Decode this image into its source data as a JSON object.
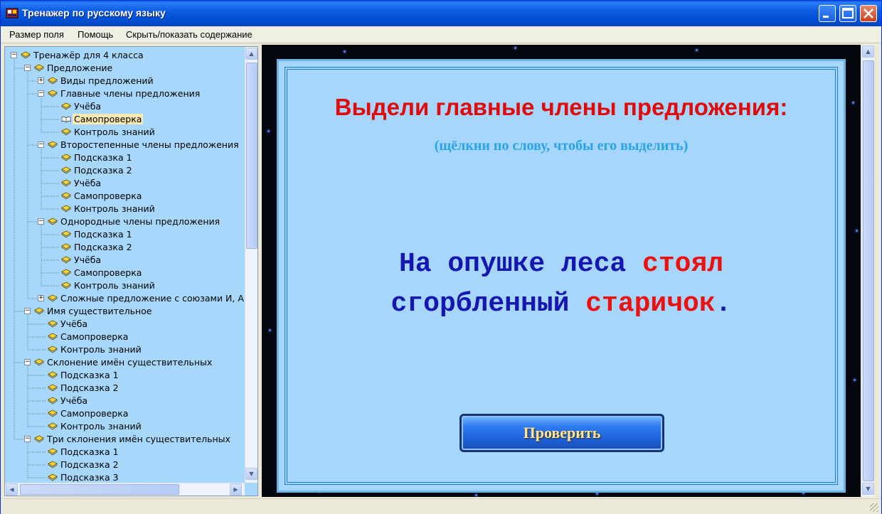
{
  "window": {
    "title": "Тренажер по русскому языку",
    "accent": "#0c5de0"
  },
  "menu": {
    "items": [
      "Размер поля",
      "Помощь",
      "Скрыть/показать содержание"
    ]
  },
  "tree": {
    "items": [
      {
        "label": "Тренажёр для 4 класса",
        "level": 0,
        "expander": "−"
      },
      {
        "label": "Предложение",
        "level": 1,
        "expander": "−"
      },
      {
        "label": "Виды предложений",
        "level": 2,
        "expander": "+"
      },
      {
        "label": "Главные члены предложения",
        "level": 2,
        "expander": "−"
      },
      {
        "label": "Учёба",
        "level": 3
      },
      {
        "label": "Самопроверка",
        "level": 3,
        "selected": true
      },
      {
        "label": "Контроль знаний",
        "level": 3
      },
      {
        "label": "Второстепенные члены предложения",
        "level": 2,
        "expander": "−"
      },
      {
        "label": "Подсказка 1",
        "level": 3
      },
      {
        "label": "Подсказка 2",
        "level": 3
      },
      {
        "label": "Учёба",
        "level": 3
      },
      {
        "label": "Самопроверка",
        "level": 3
      },
      {
        "label": "Контроль знаний",
        "level": 3
      },
      {
        "label": "Однородные члены предложения",
        "level": 2,
        "expander": "−"
      },
      {
        "label": "Подсказка 1",
        "level": 3
      },
      {
        "label": "Подсказка 2",
        "level": 3
      },
      {
        "label": "Учёба",
        "level": 3
      },
      {
        "label": "Самопроверка",
        "level": 3
      },
      {
        "label": "Контроль знаний",
        "level": 3
      },
      {
        "label": "Сложные предложение с союзами И, А,",
        "level": 2,
        "expander": "+"
      },
      {
        "label": "Имя существительное",
        "level": 1,
        "expander": "−"
      },
      {
        "label": "Учёба",
        "level": 2
      },
      {
        "label": "Самопроверка",
        "level": 2
      },
      {
        "label": "Контроль знаний",
        "level": 2
      },
      {
        "label": "Склонение имён существительных",
        "level": 1,
        "expander": "−"
      },
      {
        "label": "Подсказка 1",
        "level": 2
      },
      {
        "label": "Подсказка 2",
        "level": 2
      },
      {
        "label": "Учёба",
        "level": 2
      },
      {
        "label": "Самопроверка",
        "level": 2
      },
      {
        "label": "Контроль знаний",
        "level": 2
      },
      {
        "label": "Три склонения имён существительных",
        "level": 1,
        "expander": "−"
      },
      {
        "label": "Подсказка 1",
        "level": 2
      },
      {
        "label": "Подсказка 2",
        "level": 2
      },
      {
        "label": "Подсказка 3",
        "level": 2
      }
    ]
  },
  "exercise": {
    "heading": "Выдели главные члены предложения:",
    "subheading": "(щёлкни по слову, чтобы его выделить)",
    "sentence_words": [
      {
        "text": "На",
        "highlighted": false
      },
      {
        "text": "опушке",
        "highlighted": false
      },
      {
        "text": "леса",
        "highlighted": false
      },
      {
        "text": "стоял",
        "highlighted": true
      },
      {
        "text": "сгорбленный",
        "highlighted": false
      },
      {
        "text": "старичок",
        "highlighted": true
      }
    ],
    "sentence_end": ".",
    "check_button": "Проверить",
    "colors": {
      "heading": "#e10b0b",
      "subheading": "#2aa3ea",
      "word": "#1616b0",
      "word_highlighted": "#ec1010",
      "card": "#a6d6fb"
    }
  }
}
